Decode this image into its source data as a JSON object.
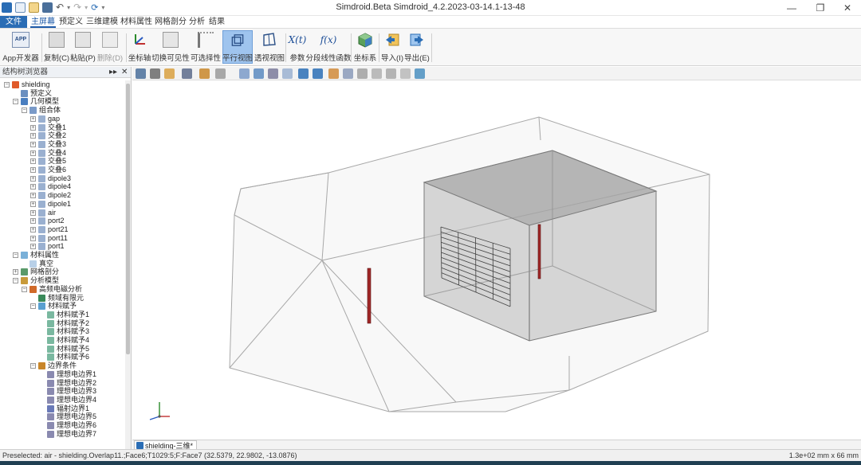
{
  "window": {
    "title": "Simdroid.Beta  Simdroid_4.2.2023-03-14.1-13-48",
    "minimize_glyph": "—",
    "restore_glyph": "❐",
    "close_glyph": "✕"
  },
  "menu": {
    "file": "文件",
    "tabs": [
      "主屏幕",
      "预定义",
      "三维建模",
      "材料属性",
      "网格剖分",
      "分析",
      "结果"
    ],
    "active_index": 0
  },
  "ribbon": {
    "buttons": [
      {
        "label": "App开发器",
        "icon": "app-icon"
      },
      {
        "label": "复制(C)",
        "icon": "copy-icon"
      },
      {
        "label": "粘贴(P)",
        "icon": "paste-icon"
      },
      {
        "label": "删除(D)",
        "icon": "delete-icon"
      },
      {
        "label": "坐标轴",
        "icon": "axis-icon"
      },
      {
        "label": "切换可见性",
        "icon": "visibility-toggle-icon"
      },
      {
        "label": "可选择性",
        "icon": "selectable-icon"
      },
      {
        "label": "平行视图",
        "icon": "parallel-view-icon"
      },
      {
        "label": "透视视图",
        "icon": "perspective-view-icon"
      },
      {
        "label": "参数",
        "icon": "parameter-icon"
      },
      {
        "label": "分段线性函数",
        "icon": "piecewise-function-icon"
      },
      {
        "label": "坐标系",
        "icon": "coordinate-system-icon"
      },
      {
        "label": "导入(I)",
        "icon": "import-icon"
      },
      {
        "label": "导出(E)",
        "icon": "export-icon"
      }
    ],
    "active_label": "平行视图",
    "app_icon_text": "APP",
    "parameter_icon_text": "X(t)",
    "function_icon_text": "f(x)"
  },
  "tree_panel": {
    "header": "结构树浏览器",
    "pin_glyph": "▸▸",
    "close_glyph": "✕",
    "items": [
      {
        "label": "shielding",
        "icon": "model-icon",
        "expander": "−"
      },
      {
        "label": "预定义",
        "icon": "predefine-icon",
        "expander": ""
      },
      {
        "label": "几何模型",
        "icon": "geometry-icon",
        "expander": "−"
      },
      {
        "label": "组合体",
        "icon": "assembly-icon",
        "expander": "−"
      },
      {
        "label": "gap",
        "icon": "body-icon",
        "expander": "+"
      },
      {
        "label": "交叠1",
        "icon": "body-icon",
        "expander": "+"
      },
      {
        "label": "交叠2",
        "icon": "body-icon",
        "expander": "+"
      },
      {
        "label": "交叠3",
        "icon": "body-icon",
        "expander": "+"
      },
      {
        "label": "交叠4",
        "icon": "body-icon",
        "expander": "+"
      },
      {
        "label": "交叠5",
        "icon": "body-icon",
        "expander": "+"
      },
      {
        "label": "交叠6",
        "icon": "body-icon",
        "expander": "+"
      },
      {
        "label": "dipole3",
        "icon": "body-icon",
        "expander": "+"
      },
      {
        "label": "dipole4",
        "icon": "body-icon",
        "expander": "+"
      },
      {
        "label": "dipole2",
        "icon": "body-icon",
        "expander": "+"
      },
      {
        "label": "dipole1",
        "icon": "body-icon",
        "expander": "+"
      },
      {
        "label": "air",
        "icon": "body-icon",
        "expander": "+"
      },
      {
        "label": "port2",
        "icon": "body-icon",
        "expander": "+"
      },
      {
        "label": "port21",
        "icon": "body-icon",
        "expander": "+"
      },
      {
        "label": "port11",
        "icon": "body-icon",
        "expander": "+"
      },
      {
        "label": "port1",
        "icon": "body-icon",
        "expander": "+"
      },
      {
        "label": "材料属性",
        "icon": "material-icon",
        "expander": "−"
      },
      {
        "label": "真空",
        "icon": "vacuum-icon",
        "expander": ""
      },
      {
        "label": "网格剖分",
        "icon": "mesh-icon",
        "expander": "+"
      },
      {
        "label": "分析模型",
        "icon": "analysis-icon",
        "expander": "−"
      },
      {
        "label": "高频电磁分析",
        "icon": "em-analysis-icon",
        "expander": "−"
      },
      {
        "label": "频域有限元",
        "icon": "fem-icon",
        "expander": ""
      },
      {
        "label": "材料赋予",
        "icon": "material-assign-icon",
        "expander": "−"
      },
      {
        "label": "材料赋予1",
        "icon": "material-assign-item-icon",
        "expander": ""
      },
      {
        "label": "材料赋予2",
        "icon": "material-assign-item-icon",
        "expander": ""
      },
      {
        "label": "材料赋予3",
        "icon": "material-assign-item-icon",
        "expander": ""
      },
      {
        "label": "材料赋予4",
        "icon": "material-assign-item-icon",
        "expander": ""
      },
      {
        "label": "材料赋予5",
        "icon": "material-assign-item-icon",
        "expander": ""
      },
      {
        "label": "材料赋予6",
        "icon": "material-assign-item-icon",
        "expander": ""
      },
      {
        "label": "边界条件",
        "icon": "boundary-icon",
        "expander": "−"
      },
      {
        "label": "理想电边界1",
        "icon": "pec-boundary-icon",
        "expander": ""
      },
      {
        "label": "理想电边界2",
        "icon": "pec-boundary-icon",
        "expander": ""
      },
      {
        "label": "理想电边界3",
        "icon": "pec-boundary-icon",
        "expander": ""
      },
      {
        "label": "理想电边界4",
        "icon": "pec-boundary-icon",
        "expander": ""
      },
      {
        "label": "辐射边界1",
        "icon": "radiation-boundary-icon",
        "expander": ""
      },
      {
        "label": "理想电边界5",
        "icon": "pec-boundary-icon",
        "expander": ""
      },
      {
        "label": "理想电边界6",
        "icon": "pec-boundary-icon",
        "expander": ""
      },
      {
        "label": "理想电边界7",
        "icon": "pec-boundary-icon",
        "expander": ""
      }
    ]
  },
  "viewport": {
    "doc_tab": "shielding-三维*",
    "background": "#ffffff",
    "scene": {
      "outer_domain": "air-domain",
      "shield_box": "shielding-enclosure",
      "aperture": "slot-aperture-grid",
      "dipoles": [
        "dipole-outside",
        "dipole-inside"
      ]
    }
  },
  "status": {
    "left": "Preselected: air - shielding.Overlap11.;Face6;T1029:5;F:Face7 (32.5379, 22.9802, -13.0876)",
    "right": "1.3e+02 mm x 66 mm"
  },
  "colors": {
    "accent": "#2a6db5",
    "active_ribbon": "#9fc4ee",
    "box_fill": "#a8a8a8",
    "dipole": "#a02828",
    "edge": "#909090"
  }
}
